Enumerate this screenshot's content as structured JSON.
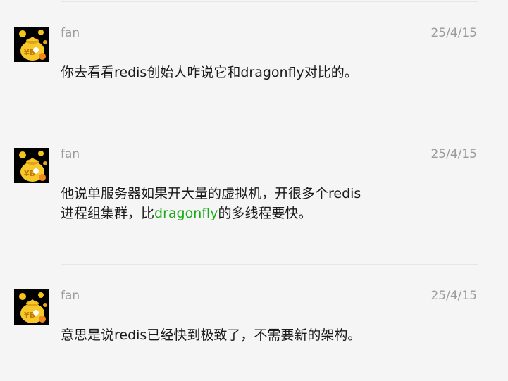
{
  "messages": [
    {
      "sender": "fan",
      "date": "25/4/15",
      "text": "你去看看redis创始人咋说它和dragonfly对比的。"
    },
    {
      "sender": "fan",
      "date": "25/4/15",
      "line1": "他说单服务器如果开大量的虚拟机，开很多个redis",
      "line2_pre": "进程组集群，比",
      "line2_link": "dragonfly",
      "line2_post": "的多线程要快。"
    },
    {
      "sender": "fan",
      "date": "25/4/15",
      "text": "意思是说redis已经快到极致了，不需要新的架构。"
    }
  ],
  "icons": {
    "avatar": "coin-bag-avatar-icon"
  },
  "colors": {
    "background": "#f5f5f5",
    "meta_text": "#9b9b9b",
    "body_text": "#1a1a1a",
    "link_green": "#1aad19",
    "divider": "#e6e6e6"
  }
}
